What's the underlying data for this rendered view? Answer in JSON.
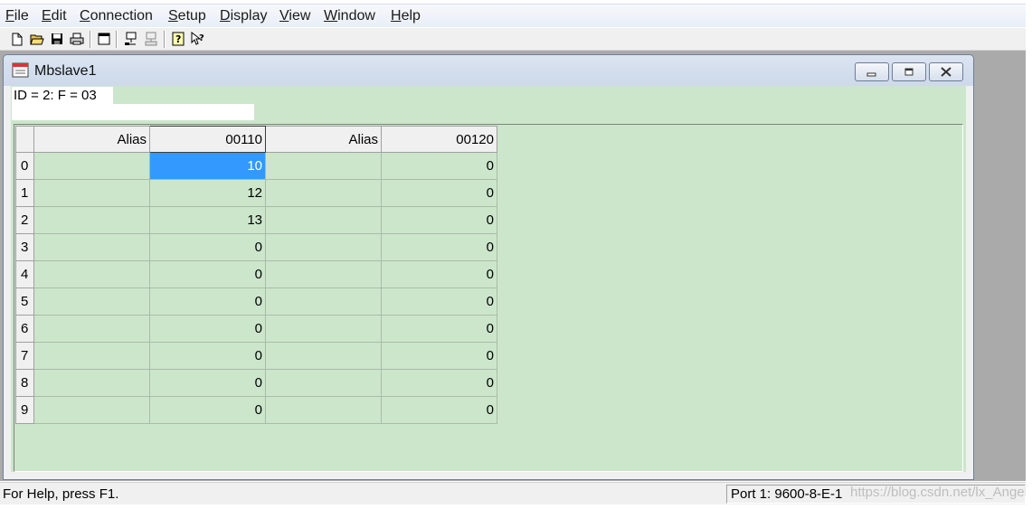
{
  "menu": {
    "items": [
      {
        "key": "F",
        "rest": "ile"
      },
      {
        "key": "E",
        "rest": "dit"
      },
      {
        "key": "C",
        "rest": "onnection"
      },
      {
        "key": "S",
        "rest": "etup"
      },
      {
        "key": "D",
        "rest": "isplay"
      },
      {
        "key": "V",
        "rest": "iew"
      },
      {
        "key": "W",
        "rest": "indow"
      },
      {
        "key": "H",
        "rest": "elp"
      }
    ]
  },
  "toolbar": {
    "icons": [
      "new-icon",
      "open-icon",
      "save-icon",
      "print-icon",
      "window-icon",
      "connect-icon",
      "disconnect-icon",
      "help-icon",
      "context-help-icon"
    ]
  },
  "window": {
    "title": "Mbslave1",
    "id_line": "ID = 2: F = 03",
    "error_line": ""
  },
  "grid": {
    "headers": [
      "",
      "Alias",
      "00110",
      "Alias",
      "00120"
    ],
    "rows": [
      {
        "index": "0",
        "alias1": "",
        "v1": "10",
        "alias2": "",
        "v2": "0"
      },
      {
        "index": "1",
        "alias1": "",
        "v1": "12",
        "alias2": "",
        "v2": "0"
      },
      {
        "index": "2",
        "alias1": "",
        "v1": "13",
        "alias2": "",
        "v2": "0"
      },
      {
        "index": "3",
        "alias1": "",
        "v1": "0",
        "alias2": "",
        "v2": "0"
      },
      {
        "index": "4",
        "alias1": "",
        "v1": "0",
        "alias2": "",
        "v2": "0"
      },
      {
        "index": "5",
        "alias1": "",
        "v1": "0",
        "alias2": "",
        "v2": "0"
      },
      {
        "index": "6",
        "alias1": "",
        "v1": "0",
        "alias2": "",
        "v2": "0"
      },
      {
        "index": "7",
        "alias1": "",
        "v1": "0",
        "alias2": "",
        "v2": "0"
      },
      {
        "index": "8",
        "alias1": "",
        "v1": "0",
        "alias2": "",
        "v2": "0"
      },
      {
        "index": "9",
        "alias1": "",
        "v1": "0",
        "alias2": "",
        "v2": "0"
      }
    ],
    "selected_row": 0,
    "selected_col": "v1"
  },
  "status": {
    "left": "For Help, press F1.",
    "right": "Port 1: 9600-8-E-1",
    "watermark": "https://blog.csdn.net/lx_Angel"
  },
  "colors": {
    "grid_bg": "#cce6cc",
    "selection": "#3399ff",
    "mdi_bg": "#aaaaaa"
  }
}
